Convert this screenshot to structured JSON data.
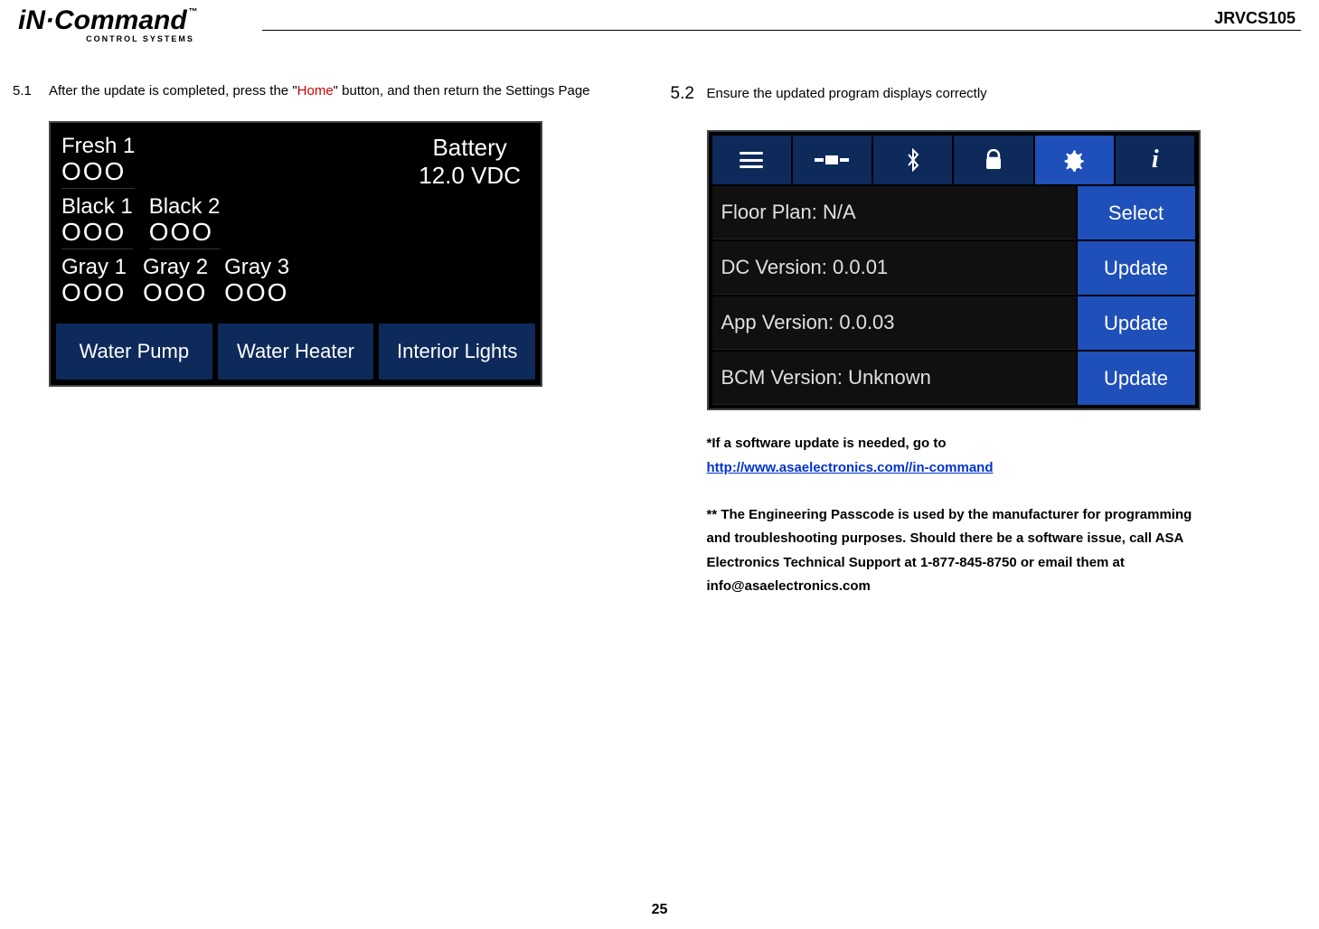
{
  "header": {
    "logo_main": "iN·Command",
    "logo_tm": "™",
    "logo_sub": "CONTROL SYSTEMS",
    "model": "JRVCS105"
  },
  "left": {
    "step_num": "5.1",
    "step_pre": "After the update is completed, press the \"",
    "step_home": "Home",
    "step_post": "\" button, and then return the Settings Page",
    "tanks": {
      "fresh1": "Fresh 1",
      "black1": "Black 1",
      "black2": "Black 2",
      "gray1": "Gray 1",
      "gray2": "Gray 2",
      "gray3": "Gray 3",
      "ooo": "OOO"
    },
    "battery": {
      "label": "Battery",
      "value": "12.0 VDC"
    },
    "buttons": {
      "pump": "Water Pump",
      "heater": "Water Heater",
      "lights": "Interior Lights"
    }
  },
  "right": {
    "step_num": "5.2",
    "step_text": "Ensure the updated program displays correctly",
    "settings": {
      "floor_label": "Floor Plan:  N/A",
      "floor_btn": "Select",
      "dc_label": "DC Version:  0.0.01",
      "dc_btn": "Update",
      "app_label": "App Version:  0.0.03",
      "app_btn": "Update",
      "bcm_label": "BCM Version:  Unknown",
      "bcm_btn": "Update"
    },
    "notes": {
      "line1": "*If a software update is needed, go to",
      "link": "http://www.asaelectronics.com//in-command",
      "para2": "** The Engineering Passcode is used by the manufacturer for programming and troubleshooting purposes. Should there be a software issue, call ASA Electronics Technical Support at 1-877-845-8750 or email them at info@asaelectronics.com"
    }
  },
  "page_number": "25"
}
